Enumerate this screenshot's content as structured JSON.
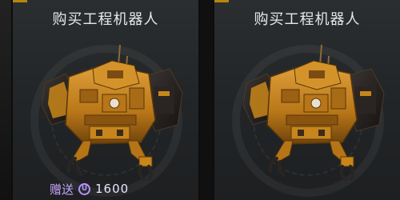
{
  "cards": [
    {
      "title": "购买工程机器人",
      "image": "engineering-robot",
      "price": {
        "label": "赠送",
        "currency_icon": "u-coin-icon",
        "currency_glyph": "U",
        "amount": "1600"
      }
    },
    {
      "title": "购买工程机器人",
      "image": "engineering-robot"
    }
  ],
  "colors": {
    "robot_body": "#c8861a",
    "robot_shadow": "#6b420c",
    "robot_dark": "#2a2522",
    "price_text": "#c7a6ff",
    "accent": "#b8860b"
  }
}
